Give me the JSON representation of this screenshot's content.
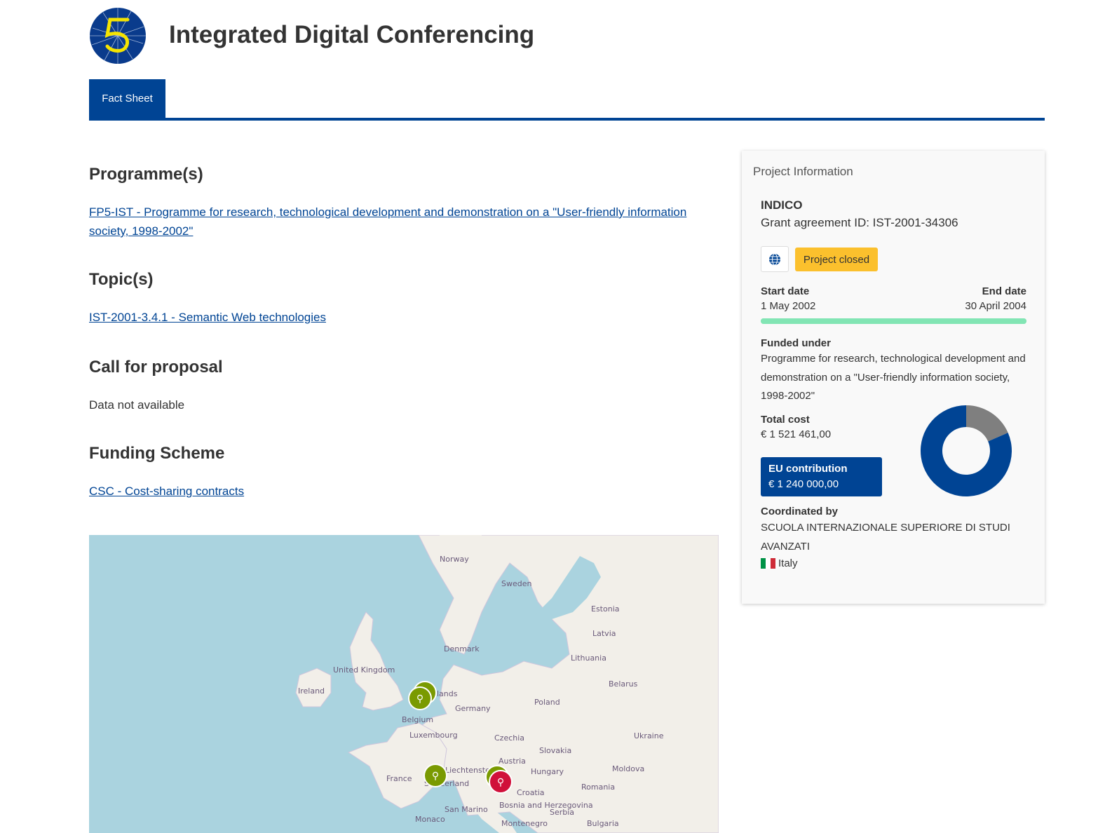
{
  "header": {
    "title": "Integrated Digital Conferencing",
    "logo": "cordis-logo"
  },
  "tabs": [
    {
      "label": "Fact Sheet",
      "active": true
    }
  ],
  "main": {
    "programme_heading": "Programme(s)",
    "programme_link": "FP5-IST - Programme for research, technological development and demonstration on a \"User-friendly information society, 1998-2002\"",
    "topic_heading": "Topic(s)",
    "topic_link": "IST-2001-3.4.1 - Semantic Web technologies",
    "call_heading": "Call for proposal",
    "call_value": "Data not available",
    "funding_heading": "Funding Scheme",
    "funding_link": "CSC - Cost-sharing contracts"
  },
  "map": {
    "labels": [
      "Norway",
      "Sweden",
      "Estonia",
      "Latvia",
      "Denmark",
      "Lithuania",
      "United Kingdom",
      "Ireland",
      "lands",
      "Germany",
      "Belarus",
      "Poland",
      "Belgium",
      "Luxembourg",
      "Czechia",
      "Ukraine",
      "Slovakia",
      "France",
      "Liechtenstein",
      "Austria",
      "Hungary",
      "Moldova",
      "Switzerland",
      "Croatia",
      "Romania",
      "Bosnia and Herzegovina",
      "Serbia",
      "San Marino",
      "Monaco",
      "Montenegro",
      "Bulgaria"
    ],
    "colors": {
      "sea": "#aad3df",
      "land": "#f2efe9",
      "participant": "#7a9a01",
      "coordinator": "#d0103a"
    }
  },
  "panel": {
    "title": "Project Information",
    "acronym": "INDICO",
    "grant": "Grant agreement ID: IST-2001-34306",
    "globe_icon": "globe-icon",
    "status": "Project closed",
    "start_label": "Start date",
    "start_value": "1 May 2002",
    "end_label": "End date",
    "end_value": "30 April 2004",
    "progress_percent": 100,
    "funded_label": "Funded under",
    "funded_value": "Programme for research, technological development and demonstration on a \"User-friendly information society, 1998-2002\"",
    "total_cost_label": "Total cost",
    "total_cost_value": "€ 1 521 461,00",
    "eu_label": "EU contribution",
    "eu_value": "€ 1 240 000,00",
    "donut": {
      "total": 1521461.0,
      "eu": 1240000.0,
      "eu_color": "#004494",
      "rest_color": "#7f7f7f"
    },
    "coordinated_label": "Coordinated by",
    "coordinated_value": "SCUOLA INTERNAZIONALE SUPERIORE DI STUDI AVANZATI",
    "country": "Italy"
  }
}
